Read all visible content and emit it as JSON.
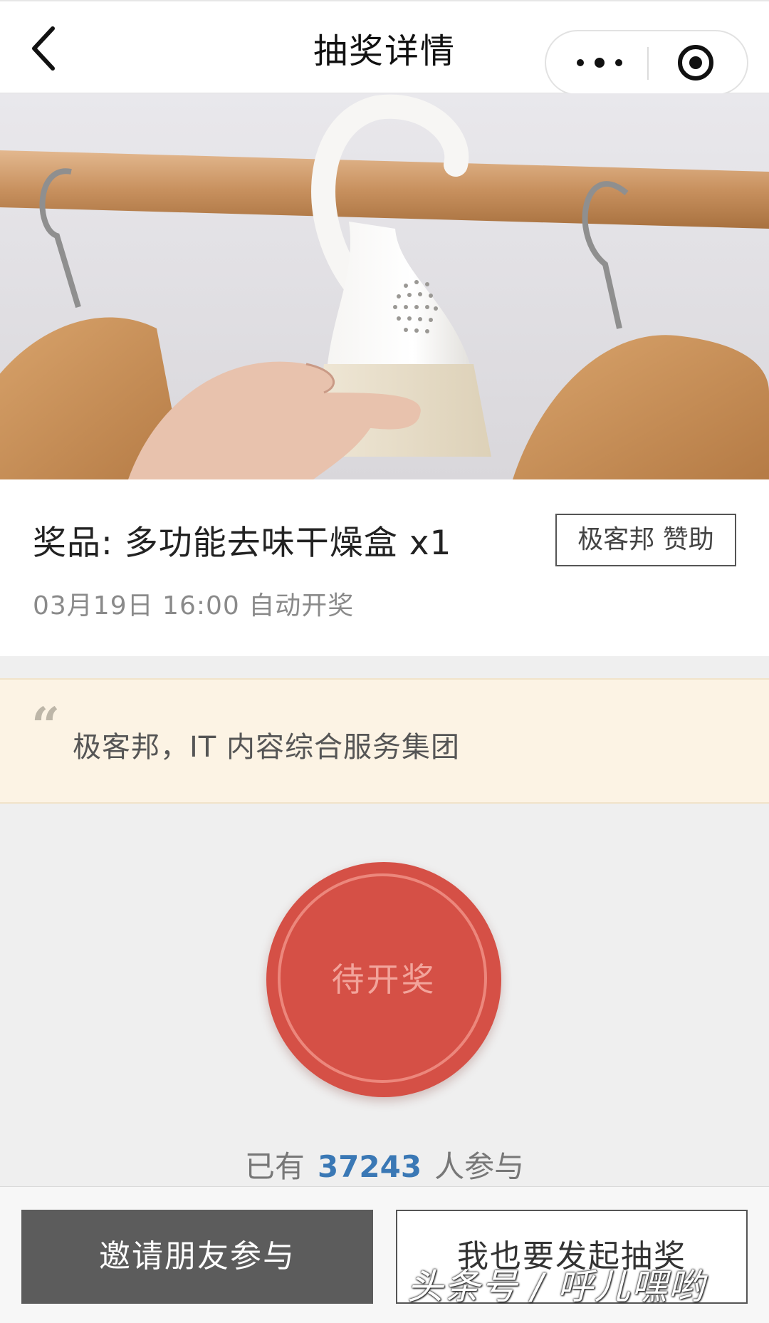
{
  "navbar": {
    "title": "抽奖详情"
  },
  "prize": {
    "title": "奖品: 多功能去味干燥盒  x1",
    "sponsor_label": "极客邦 赞助",
    "draw_time": "03月19日 16:00 自动开奖"
  },
  "quote": {
    "mark": "“",
    "text": "极客邦，IT 内容综合服务集团"
  },
  "draw_button": {
    "label": "待开奖"
  },
  "participants": {
    "prefix": "已有",
    "count": "37243",
    "suffix": "人参与"
  },
  "bottom": {
    "invite_label": "邀请朋友参与",
    "start_label": "我也要发起抽奖"
  },
  "watermark": "头条号 / 呼儿嘿哟",
  "colors": {
    "draw_red": "#d55046",
    "count_blue": "#3a78b5",
    "quote_bg": "#fcf3e4",
    "invite_bg": "#5c5c5c"
  },
  "icons": {
    "back": "chevron-left-icon",
    "more": "more-dots-icon",
    "close_target": "target-circle-icon",
    "quote": "quote-icon"
  }
}
